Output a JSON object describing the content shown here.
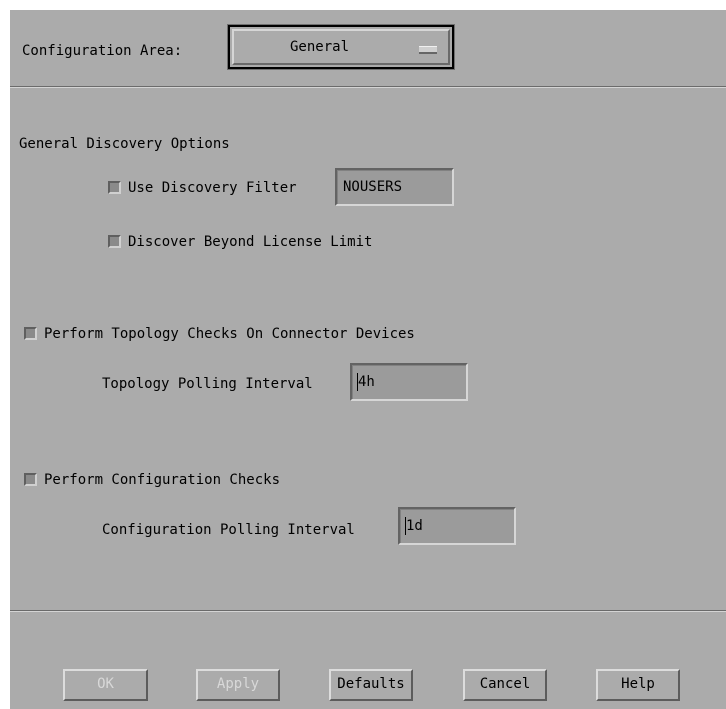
{
  "configuration": {
    "label": "Configuration Area:",
    "selected": "General",
    "menu_indicator_icon": "option-menu-bar-icon"
  },
  "general": {
    "section_title": "General Discovery Options",
    "use_filter": {
      "label": "Use Discovery Filter",
      "value": "NOUSERS"
    },
    "beyond_license": {
      "label": "Discover Beyond License Limit"
    }
  },
  "topology": {
    "checks_label": "Perform Topology Checks On Connector Devices",
    "interval_label": "Topology Polling Interval",
    "interval_value": "4h"
  },
  "configuration_checks": {
    "checks_label": "Perform Configuration Checks",
    "interval_label": "Configuration Polling Interval",
    "interval_value": "1d"
  },
  "buttons": {
    "ok": "OK",
    "apply": "Apply",
    "defaults": "Defaults",
    "cancel": "Cancel",
    "help": "Help"
  }
}
